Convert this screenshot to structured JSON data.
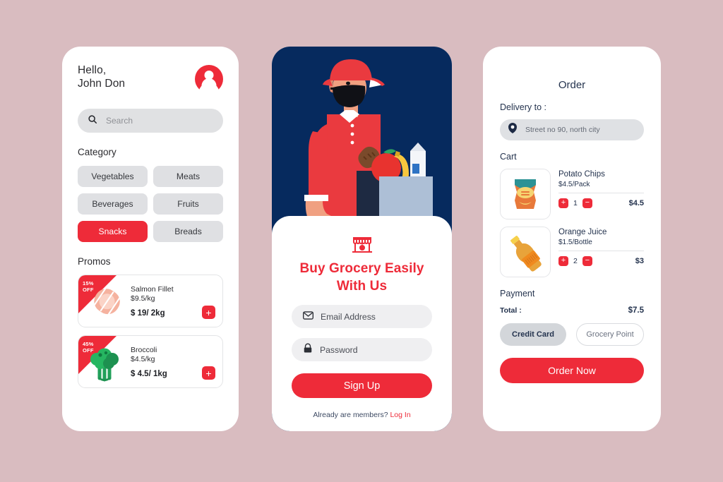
{
  "theme": {
    "page_background": "#d9bcc0",
    "accent_red": "#ee2b39",
    "navy": "#062a5e",
    "text_navy": "#24334e",
    "chip_grey": "#dfe0e3"
  },
  "home": {
    "greeting_line1": "Hello,",
    "greeting_line2": "John Don",
    "avatar_icon": "user-avatar-icon",
    "search": {
      "icon": "search-icon",
      "placeholder": "Search",
      "value": ""
    },
    "category_title": "Category",
    "categories": [
      {
        "label": "Vegetables",
        "active": false
      },
      {
        "label": "Meats",
        "active": false
      },
      {
        "label": "Beverages",
        "active": false
      },
      {
        "label": "Fruits",
        "active": false
      },
      {
        "label": "Snacks",
        "active": true
      },
      {
        "label": "Breads",
        "active": false
      }
    ],
    "promos_title": "Promos",
    "promos": [
      {
        "badge_line1": "15%",
        "badge_line2": "OFF",
        "name": "Salmon Fillet",
        "unit_price": "$9.5/kg",
        "total_price": "$ 19/ 2kg",
        "image": "salmon-fillet-image",
        "add_label": "+"
      },
      {
        "badge_line1": "45%",
        "badge_line2": "OFF",
        "name": "Broccoli",
        "unit_price": "$4.5/kg",
        "total_price": "$ 4.5/ 1kg",
        "image": "broccoli-image",
        "add_label": "+"
      }
    ]
  },
  "auth": {
    "hero_image": "delivery-person-illustration",
    "store_icon": "grocery-store-icon",
    "title_line1": "Buy Grocery Easily",
    "title_line2": "With Us",
    "email": {
      "icon": "envelope-icon",
      "placeholder": "Email Address",
      "value": ""
    },
    "password": {
      "icon": "lock-icon",
      "placeholder": "Password",
      "value": ""
    },
    "signup_label": "Sign Up",
    "footer_text": "Already are members?",
    "login_label": "Log In"
  },
  "order": {
    "title": "Order",
    "delivery_label": "Delivery to :",
    "address": {
      "icon": "map-pin-icon",
      "value": "Street no 90, north city"
    },
    "cart_label": "Cart",
    "cart_items": [
      {
        "name": "Potato Chips",
        "unit_price": "$4.5/Pack",
        "quantity": "1",
        "line_total": "$4.5",
        "image": "potato-chips-image",
        "increase_label": "+",
        "decrease_label": "−"
      },
      {
        "name": "Orange Juice",
        "unit_price": "$1.5/Bottle",
        "quantity": "2",
        "line_total": "$3",
        "image": "orange-juice-image",
        "increase_label": "+",
        "decrease_label": "−"
      }
    ],
    "payment_label": "Payment",
    "total_label": "Total :",
    "total_value": "$7.5",
    "payment_methods": [
      {
        "label": "Credit Card",
        "selected": true
      },
      {
        "label": "Grocery Point",
        "selected": false
      }
    ],
    "order_button_label": "Order Now"
  }
}
